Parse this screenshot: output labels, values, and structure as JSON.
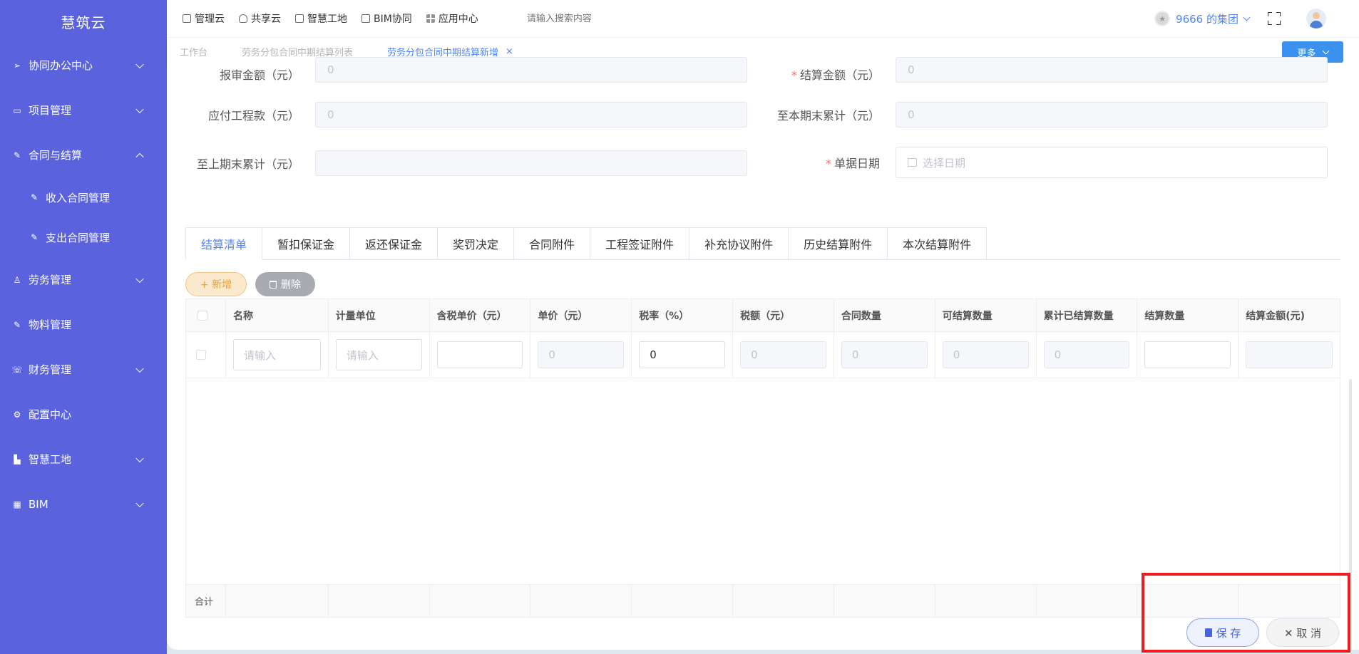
{
  "brand": "慧筑云",
  "sidebar": {
    "items": [
      {
        "label": "协同办公中心",
        "icon": "send-icon",
        "expanded": false
      },
      {
        "label": "项目管理",
        "icon": "book-icon",
        "expanded": false
      },
      {
        "label": "合同与结算",
        "icon": "edit-icon",
        "expanded": true
      },
      {
        "label": "劳务管理",
        "icon": "user-icon",
        "expanded": false
      },
      {
        "label": "物料管理",
        "icon": "edit-icon"
      },
      {
        "label": "财务管理",
        "icon": "phone-icon",
        "expanded": false
      },
      {
        "label": "配置中心",
        "icon": "gear-icon"
      },
      {
        "label": "智慧工地",
        "icon": "bar-chart-icon",
        "expanded": false
      },
      {
        "label": "BIM",
        "icon": "grid-icon",
        "expanded": false
      }
    ],
    "subitems": [
      {
        "label": "收入合同管理",
        "icon": "edit-icon"
      },
      {
        "label": "支出合同管理",
        "icon": "edit-icon"
      }
    ]
  },
  "topbar": {
    "links": [
      {
        "label": "管理云",
        "icon": "doc-icon"
      },
      {
        "label": "共享云",
        "icon": "cloud-icon"
      },
      {
        "label": "智慧工地",
        "icon": "doc-icon"
      },
      {
        "label": "BIM协同",
        "icon": "doc-icon"
      },
      {
        "label": "应用中心",
        "icon": "grid-icon"
      }
    ],
    "search_placeholder": "请输入搜索内容",
    "group_name": "9666 的集团"
  },
  "page_tabs": [
    {
      "label": "工作台",
      "active": false
    },
    {
      "label": "劳务分包合同中期结算列表",
      "active": false
    },
    {
      "label": "劳务分包合同中期结算新增",
      "active": true,
      "close": "×"
    }
  ],
  "more_label": "更多",
  "form": {
    "report_amount": {
      "label": "报审金额（元）",
      "value": "0"
    },
    "settle_amount": {
      "label": "结算金额（元）",
      "value": "0",
      "required": "*"
    },
    "payable": {
      "label": "应付工程款（元）",
      "value": "0"
    },
    "cum_current": {
      "label": "至本期末累计（元）",
      "value": "0"
    },
    "cum_previous": {
      "label": "至上期末累计（元）",
      "value": ""
    },
    "doc_date": {
      "label": "单据日期",
      "placeholder": "选择日期",
      "required": "*"
    }
  },
  "tabs": [
    "结算清单",
    "暂扣保证金",
    "返还保证金",
    "奖罚决定",
    "合同附件",
    "工程签证附件",
    "补充协议附件",
    "历史结算附件",
    "本次结算附件"
  ],
  "actions": {
    "add": "+ 新增",
    "delete": "删除"
  },
  "table": {
    "headers": [
      "名称",
      "计量单位",
      "含税单价（元）",
      "单价（元）",
      "税率（%）",
      "税额（元）",
      "合同数量",
      "可结算数量",
      "累计已结算数量",
      "结算数量",
      "结算金额(元)"
    ],
    "row": {
      "name_placeholder": "请输入",
      "unit_placeholder": "请输入",
      "price": "0",
      "tax_rate": "0",
      "tax": "0",
      "contract_qty": "0",
      "settleable_qty": "0",
      "settled_qty": "0"
    },
    "footer_label": "合计"
  },
  "buttons": {
    "save": "保 存",
    "cancel": "✕ 取 消"
  }
}
